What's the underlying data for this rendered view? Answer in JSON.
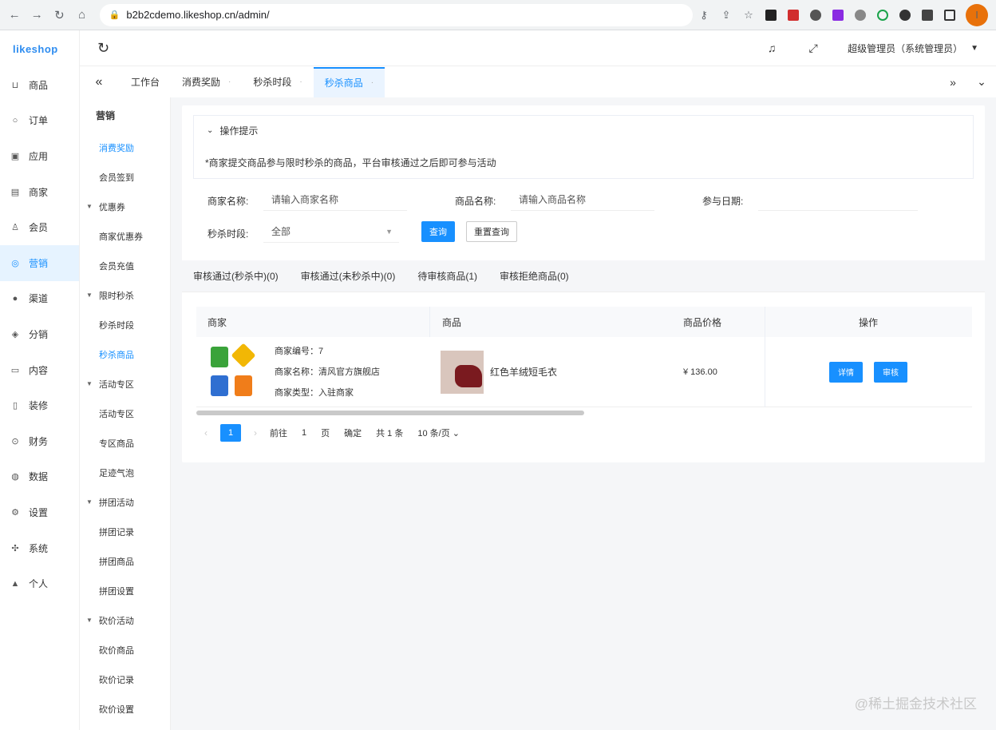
{
  "browser": {
    "url": "b2b2cdemo.likeshop.cn/admin/",
    "avatar_letter": "I"
  },
  "app": {
    "logo": "likeshop",
    "admin_label": "超级管理员（系统管理员）"
  },
  "main_nav": [
    {
      "label": "商品",
      "icon": "cart-icon",
      "glyph": "⊔"
    },
    {
      "label": "订单",
      "icon": "order-icon",
      "glyph": "○"
    },
    {
      "label": "应用",
      "icon": "app-icon",
      "glyph": "▣"
    },
    {
      "label": "商家",
      "icon": "shop-icon",
      "glyph": "▤"
    },
    {
      "label": "会员",
      "icon": "user-icon",
      "glyph": "♙"
    },
    {
      "label": "营销",
      "icon": "marketing-icon",
      "glyph": "◎",
      "active": true
    },
    {
      "label": "渠道",
      "icon": "channel-icon",
      "glyph": "●"
    },
    {
      "label": "分销",
      "icon": "distribution-icon",
      "glyph": "◈"
    },
    {
      "label": "内容",
      "icon": "content-icon",
      "glyph": "▭"
    },
    {
      "label": "装修",
      "icon": "decoration-icon",
      "glyph": "▯"
    },
    {
      "label": "财务",
      "icon": "finance-icon",
      "glyph": "⊙"
    },
    {
      "label": "数据",
      "icon": "data-icon",
      "glyph": "◍"
    },
    {
      "label": "设置",
      "icon": "settings-icon",
      "glyph": "⚙"
    },
    {
      "label": "系统",
      "icon": "system-icon",
      "glyph": "✣"
    },
    {
      "label": "个人",
      "icon": "person-icon",
      "glyph": "▲"
    }
  ],
  "sub_nav": {
    "title": "营销",
    "items": [
      {
        "type": "item",
        "label": "消费奖励",
        "active": true
      },
      {
        "type": "item",
        "label": "会员签到"
      },
      {
        "type": "group",
        "label": "优惠券"
      },
      {
        "type": "item",
        "label": "商家优惠券"
      },
      {
        "type": "item",
        "label": "会员充值"
      },
      {
        "type": "group",
        "label": "限时秒杀"
      },
      {
        "type": "item",
        "label": "秒杀时段"
      },
      {
        "type": "item",
        "label": "秒杀商品",
        "active": true
      },
      {
        "type": "group",
        "label": "活动专区"
      },
      {
        "type": "item",
        "label": "活动专区"
      },
      {
        "type": "item",
        "label": "专区商品"
      },
      {
        "type": "item",
        "label": "足迹气泡"
      },
      {
        "type": "group",
        "label": "拼团活动"
      },
      {
        "type": "item",
        "label": "拼团记录"
      },
      {
        "type": "item",
        "label": "拼团商品"
      },
      {
        "type": "item",
        "label": "拼团设置"
      },
      {
        "type": "group",
        "label": "砍价活动"
      },
      {
        "type": "item",
        "label": "砍价商品"
      },
      {
        "type": "item",
        "label": "砍价记录"
      },
      {
        "type": "item",
        "label": "砍价设置"
      }
    ]
  },
  "tabs": [
    {
      "label": "工作台",
      "closable": false
    },
    {
      "label": "消费奖励",
      "closable": true
    },
    {
      "label": "秒杀时段",
      "closable": true
    },
    {
      "label": "秒杀商品",
      "closable": true,
      "active": true
    }
  ],
  "tips": {
    "title": "操作提示",
    "text": "*商家提交商品参与限时秒杀的商品，平台审核通过之后即可参与活动"
  },
  "filters": {
    "shop_name_label": "商家名称:",
    "shop_name_placeholder": "请输入商家名称",
    "goods_name_label": "商品名称:",
    "goods_name_placeholder": "请输入商品名称",
    "date_label": "参与日期:",
    "period_label": "秒杀时段:",
    "period_value": "全部",
    "query_button": "查询",
    "reset_button": "重置查询"
  },
  "list_tabs": [
    "审核通过(秒杀中)(0)",
    "审核通过(未秒杀中)(0)",
    "待审核商品(1)",
    "审核拒绝商品(0)"
  ],
  "table": {
    "headers": {
      "shop": "商家",
      "goods": "商品",
      "price": "商品价格",
      "actions": "操作"
    },
    "rows": [
      {
        "shop_id": "商家编号：7",
        "shop_name": "商家名称：清风官方旗舰店",
        "shop_type": "商家类型：入驻商家",
        "goods_name": "红色羊绒短毛衣",
        "price": "¥ 136.00",
        "detail_button": "详情",
        "audit_button": "审核"
      }
    ]
  },
  "pagination": {
    "current": "1",
    "goto_label": "前往",
    "goto_value": "1",
    "page_unit": "页",
    "confirm": "确定",
    "total": "共 1 条",
    "page_size": "10 条/页"
  },
  "watermark": "@稀土掘金技术社区",
  "colors": {
    "accent": "#1890ff",
    "logo_green": "#3aa33a",
    "logo_yellow": "#f2b705",
    "logo_blue": "#2f6fd1",
    "logo_orange": "#f07d1a"
  }
}
